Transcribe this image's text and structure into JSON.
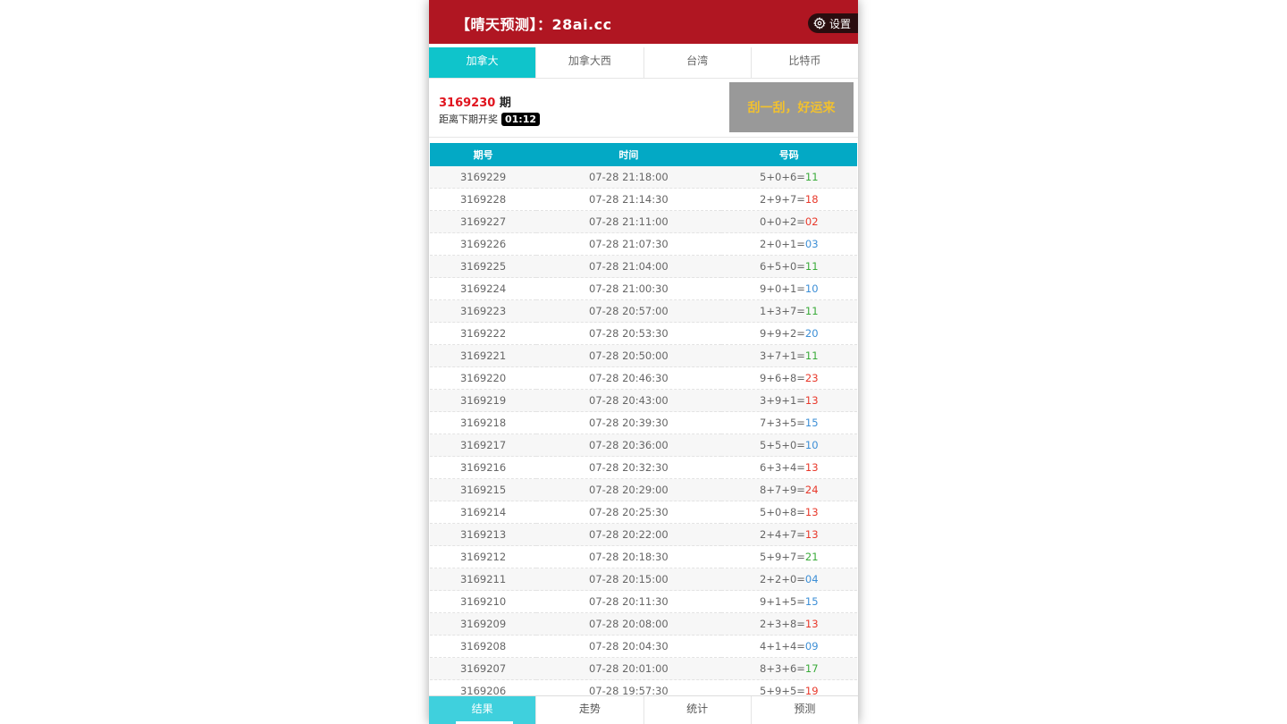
{
  "header": {
    "title": "【晴天预测】：28ai.cc",
    "settings_label": "设置"
  },
  "tabs": [
    {
      "label": "加拿大",
      "active": true
    },
    {
      "label": "加拿大西",
      "active": false
    },
    {
      "label": "台湾",
      "active": false
    },
    {
      "label": "比特币",
      "active": false
    }
  ],
  "current": {
    "period_num": "3169230",
    "period_suffix": " 期",
    "countdown_label": "距离下期开奖",
    "countdown": "01:12"
  },
  "scratch_card": {
    "label": "刮一刮，好运来"
  },
  "table": {
    "headers": [
      "期号",
      "时间",
      "号码"
    ],
    "rows": [
      {
        "id": "3169229",
        "time": "07-28 21:18:00",
        "expr": "5+0+6=",
        "sum": "11",
        "color": "green"
      },
      {
        "id": "3169228",
        "time": "07-28 21:14:30",
        "expr": "2+9+7=",
        "sum": "18",
        "color": "red"
      },
      {
        "id": "3169227",
        "time": "07-28 21:11:00",
        "expr": "0+0+2=",
        "sum": "02",
        "color": "red"
      },
      {
        "id": "3169226",
        "time": "07-28 21:07:30",
        "expr": "2+0+1=",
        "sum": "03",
        "color": "blue"
      },
      {
        "id": "3169225",
        "time": "07-28 21:04:00",
        "expr": "6+5+0=",
        "sum": "11",
        "color": "green"
      },
      {
        "id": "3169224",
        "time": "07-28 21:00:30",
        "expr": "9+0+1=",
        "sum": "10",
        "color": "blue"
      },
      {
        "id": "3169223",
        "time": "07-28 20:57:00",
        "expr": "1+3+7=",
        "sum": "11",
        "color": "green"
      },
      {
        "id": "3169222",
        "time": "07-28 20:53:30",
        "expr": "9+9+2=",
        "sum": "20",
        "color": "blue"
      },
      {
        "id": "3169221",
        "time": "07-28 20:50:00",
        "expr": "3+7+1=",
        "sum": "11",
        "color": "green"
      },
      {
        "id": "3169220",
        "time": "07-28 20:46:30",
        "expr": "9+6+8=",
        "sum": "23",
        "color": "red"
      },
      {
        "id": "3169219",
        "time": "07-28 20:43:00",
        "expr": "3+9+1=",
        "sum": "13",
        "color": "red"
      },
      {
        "id": "3169218",
        "time": "07-28 20:39:30",
        "expr": "7+3+5=",
        "sum": "15",
        "color": "blue"
      },
      {
        "id": "3169217",
        "time": "07-28 20:36:00",
        "expr": "5+5+0=",
        "sum": "10",
        "color": "blue"
      },
      {
        "id": "3169216",
        "time": "07-28 20:32:30",
        "expr": "6+3+4=",
        "sum": "13",
        "color": "red"
      },
      {
        "id": "3169215",
        "time": "07-28 20:29:00",
        "expr": "8+7+9=",
        "sum": "24",
        "color": "red"
      },
      {
        "id": "3169214",
        "time": "07-28 20:25:30",
        "expr": "5+0+8=",
        "sum": "13",
        "color": "red"
      },
      {
        "id": "3169213",
        "time": "07-28 20:22:00",
        "expr": "2+4+7=",
        "sum": "13",
        "color": "red"
      },
      {
        "id": "3169212",
        "time": "07-28 20:18:30",
        "expr": "5+9+7=",
        "sum": "21",
        "color": "green"
      },
      {
        "id": "3169211",
        "time": "07-28 20:15:00",
        "expr": "2+2+0=",
        "sum": "04",
        "color": "blue"
      },
      {
        "id": "3169210",
        "time": "07-28 20:11:30",
        "expr": "9+1+5=",
        "sum": "15",
        "color": "blue"
      },
      {
        "id": "3169209",
        "time": "07-28 20:08:00",
        "expr": "2+3+8=",
        "sum": "13",
        "color": "red"
      },
      {
        "id": "3169208",
        "time": "07-28 20:04:30",
        "expr": "4+1+4=",
        "sum": "09",
        "color": "blue"
      },
      {
        "id": "3169207",
        "time": "07-28 20:01:00",
        "expr": "8+3+6=",
        "sum": "17",
        "color": "green"
      },
      {
        "id": "3169206",
        "time": "07-28 19:57:30",
        "expr": "5+9+5=",
        "sum": "19",
        "color": "red"
      }
    ]
  },
  "bottom_nav": [
    {
      "label": "结果",
      "active": true
    },
    {
      "label": "走势",
      "active": false
    },
    {
      "label": "统计",
      "active": false
    },
    {
      "label": "预测",
      "active": false
    }
  ],
  "colors": {
    "header": "#b01622",
    "active_tab": "#0fc4cb",
    "table_header": "#03a9c5",
    "green": "#3aab3a",
    "red": "#e8392b",
    "blue": "#3d8fd6"
  }
}
